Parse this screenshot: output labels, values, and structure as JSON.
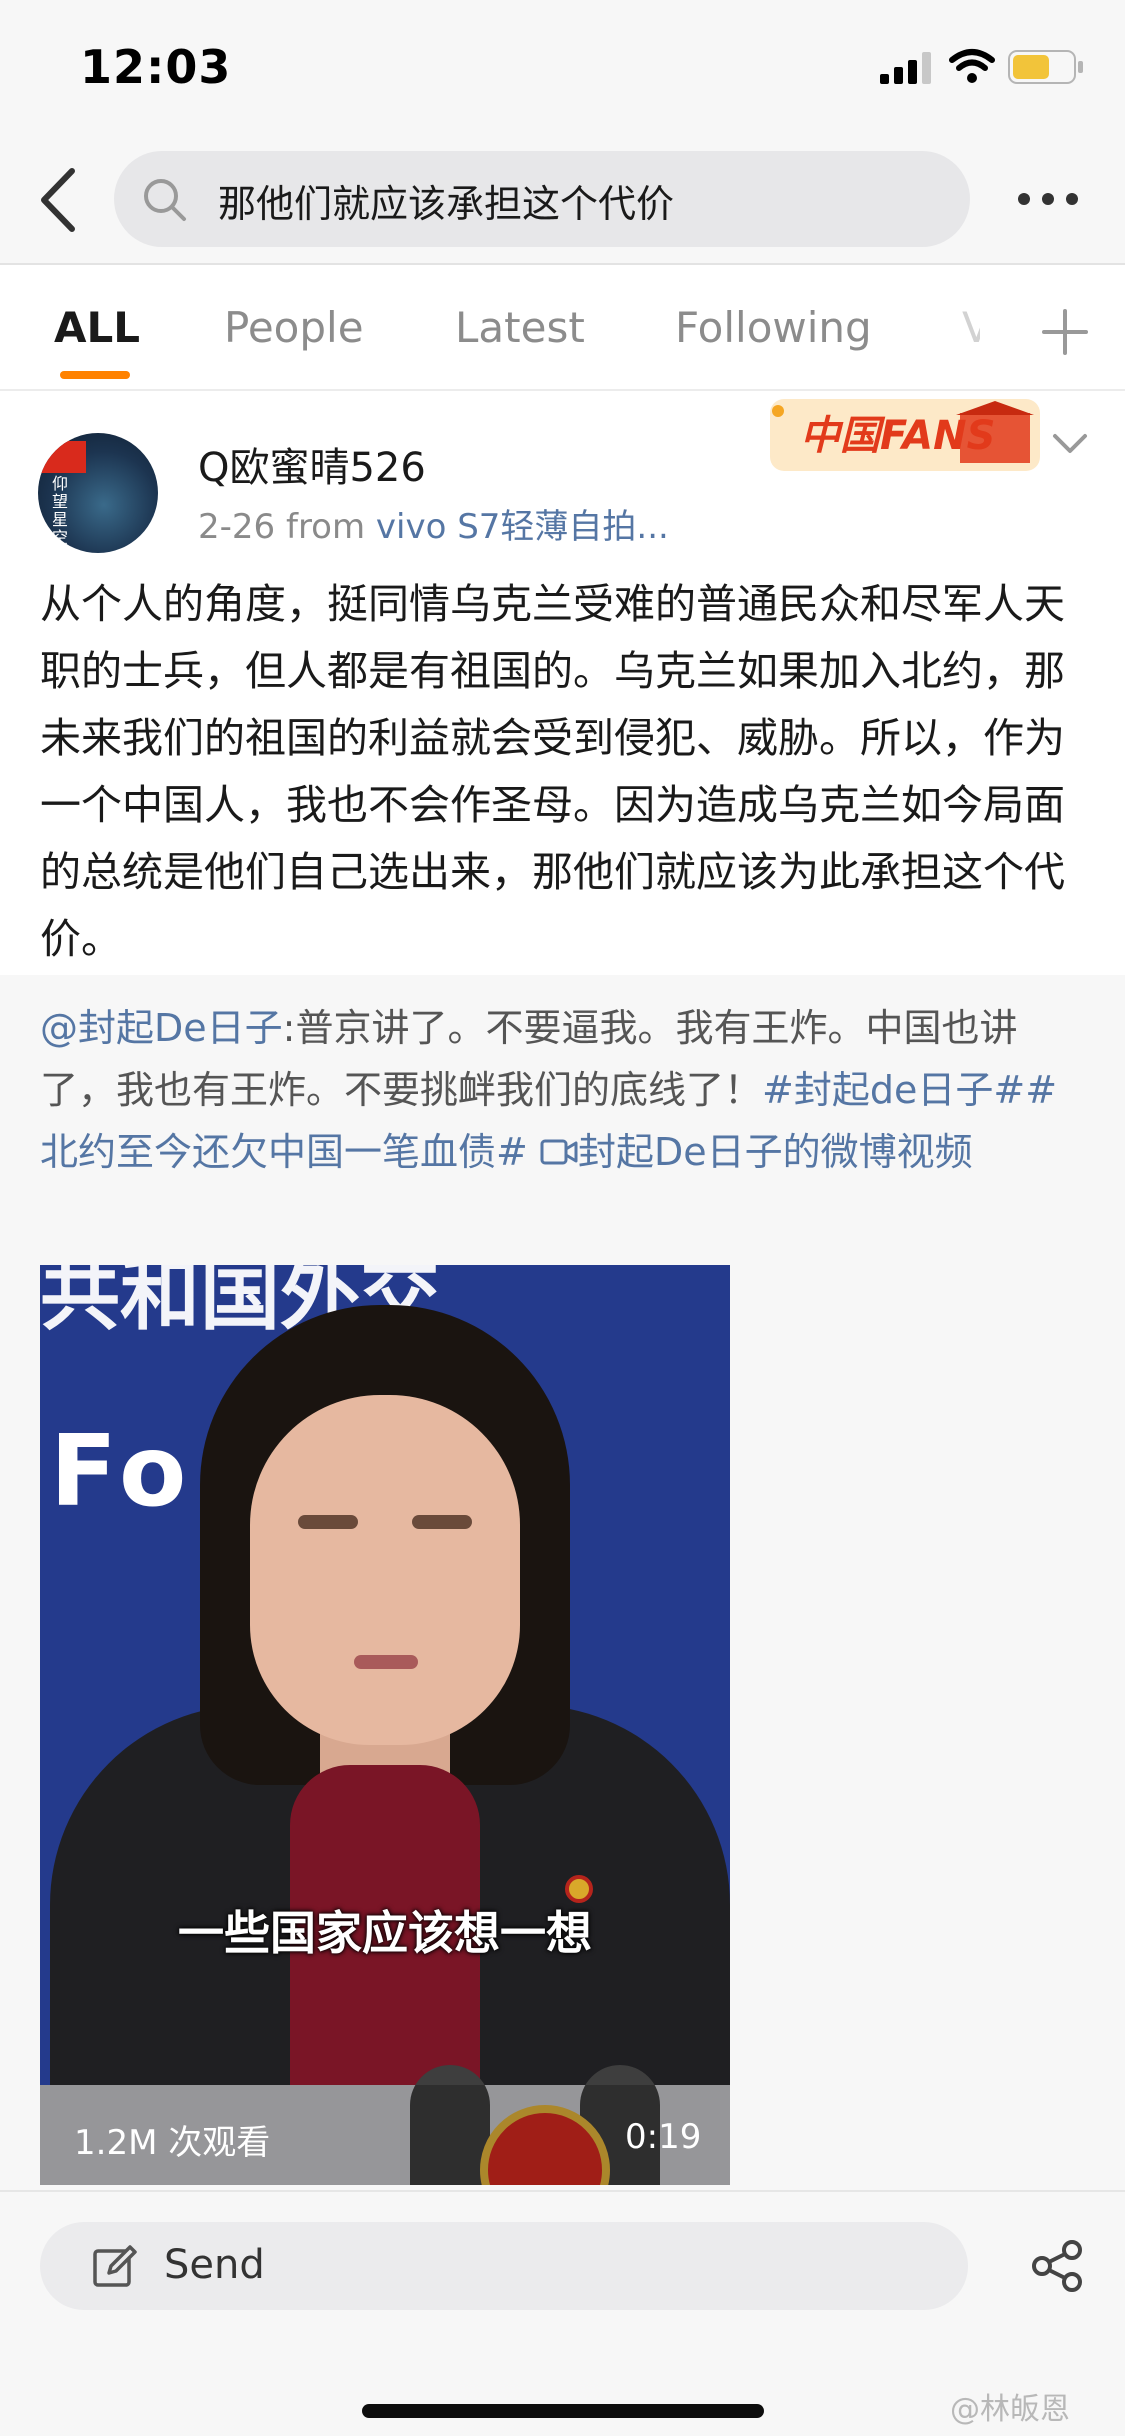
{
  "status_bar": {
    "time": "12:03"
  },
  "search": {
    "query": "那他们就应该承担这个代价"
  },
  "tabs": [
    {
      "label": "ALL",
      "active": true
    },
    {
      "label": "People",
      "active": false
    },
    {
      "label": "Latest",
      "active": false
    },
    {
      "label": "Following",
      "active": false
    }
  ],
  "tab_overflow_hint": "V",
  "post": {
    "avatar_caption": "仰望星空",
    "username": "Q欧蜜晴526",
    "date": "2-26",
    "from_label": "from",
    "source": "vivo S7轻薄自拍...",
    "badge_text": "中国FANS",
    "body": "从个人的角度，挺同情乌克兰受难的普通民众和尽军人天职的士兵，但人都是有祖国的。乌克兰如果加入北约，那未来我们的祖国的利益就会受到侵犯、威胁。所以，作为一个中国人，我也不会作圣母。因为造成乌克兰如今局面的总统是他们自己选出来，那他们就应该为此承担这个代价。"
  },
  "repost": {
    "mention": "@封起De日子",
    "text": ":普京讲了。不要逼我。我有王炸。中国也讲了，我也有王炸。不要挑衅我们的底线了！",
    "hashtag1": "#封起de日子#",
    "hashtag2": "#北约至今还欠中国一笔血债#",
    "video_link": "封起De日子的微博视频",
    "video": {
      "banner_top": "共和国外交",
      "banner_mid": "Fo   Af",
      "subtitle": "一些国家应该想一想",
      "views": "1.2M 次观看",
      "duration": "0:19"
    }
  },
  "bottom": {
    "send_label": "Send",
    "watermark": "@林皈恩"
  },
  "colors": {
    "accent": "#ff8200",
    "link": "#5576a4"
  }
}
